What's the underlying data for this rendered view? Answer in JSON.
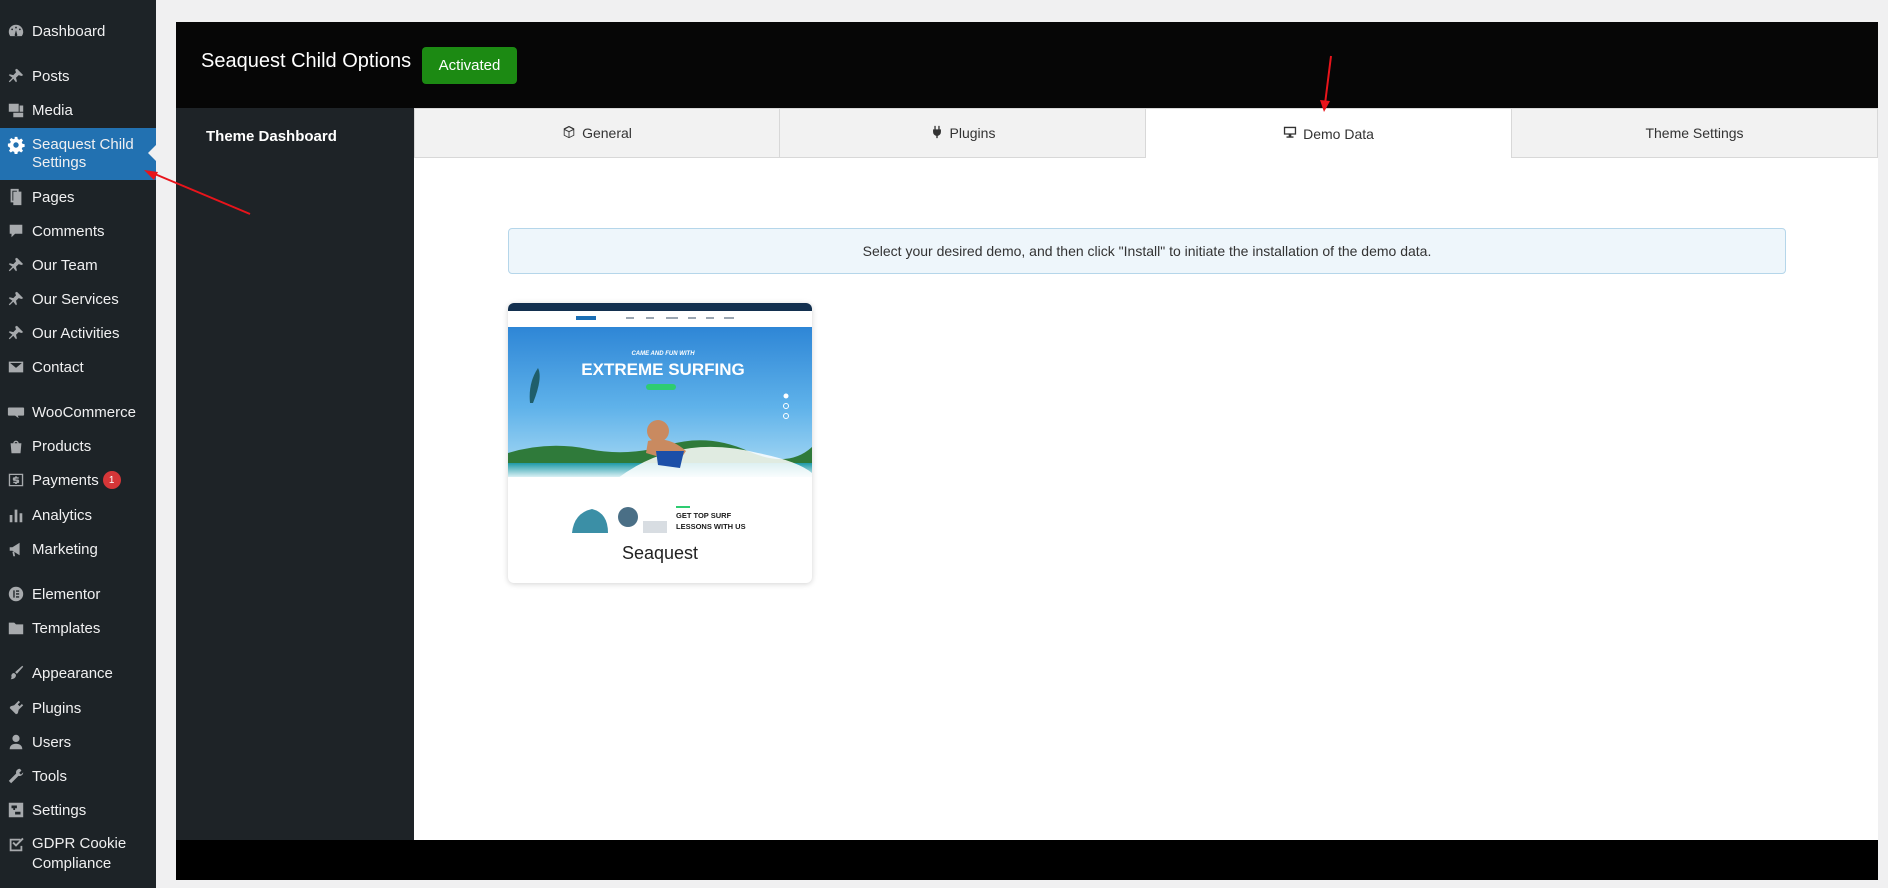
{
  "sidebar": {
    "items": [
      {
        "label": "Dashboard",
        "icon": "dashboard-icon"
      },
      {
        "label": "Posts",
        "icon": "pushpin-icon"
      },
      {
        "label": "Media",
        "icon": "media-icon"
      },
      {
        "label": "Seaquest Child Settings",
        "icon": "gear-icon",
        "active": true
      },
      {
        "label": "Pages",
        "icon": "pages-icon"
      },
      {
        "label": "Comments",
        "icon": "comment-icon"
      },
      {
        "label": "Our Team",
        "icon": "pushpin-icon"
      },
      {
        "label": "Our Services",
        "icon": "pushpin-icon"
      },
      {
        "label": "Our Activities",
        "icon": "pushpin-icon"
      },
      {
        "label": "Contact",
        "icon": "envelope-icon"
      },
      {
        "label": "WooCommerce",
        "icon": "woocommerce-icon"
      },
      {
        "label": "Products",
        "icon": "products-icon"
      },
      {
        "label": "Payments",
        "icon": "dollar-icon",
        "badge": "1"
      },
      {
        "label": "Analytics",
        "icon": "bar-chart-icon"
      },
      {
        "label": "Marketing",
        "icon": "megaphone-icon"
      },
      {
        "label": "Elementor",
        "icon": "elementor-icon"
      },
      {
        "label": "Templates",
        "icon": "folder-icon"
      },
      {
        "label": "Appearance",
        "icon": "paintbrush-icon"
      },
      {
        "label": "Plugins",
        "icon": "plug-icon"
      },
      {
        "label": "Users",
        "icon": "user-icon"
      },
      {
        "label": "Tools",
        "icon": "wrench-icon"
      },
      {
        "label": "Settings",
        "icon": "sliders-icon"
      },
      {
        "label": "GDPR Cookie Compliance",
        "icon": "checkbox-icon"
      }
    ]
  },
  "options": {
    "title": "Seaquest Child Options",
    "status": "Activated",
    "nav": {
      "theme_dashboard": "Theme Dashboard"
    },
    "tabs": [
      {
        "label": "General",
        "icon": "cube-icon"
      },
      {
        "label": "Plugins",
        "icon": "plug-icon"
      },
      {
        "label": "Demo Data",
        "icon": "monitor-icon",
        "active": true
      },
      {
        "label": "Theme Settings"
      }
    ],
    "notice": "Select your desired demo, and then click \"Install\" to initiate the installation of the demo data.",
    "demos": [
      {
        "name": "Seaquest",
        "preview": {
          "hero_kicker": "CAME AND FUN WITH",
          "hero_title": "EXTREME SURFING",
          "section_title_line1": "GET TOP SURF",
          "section_title_line2": "LESSONS WITH US"
        }
      }
    ]
  },
  "colors": {
    "wp_sidebar": "#1d2327",
    "wp_active": "#2271b1",
    "activated_green": "#1c8a13",
    "annotation_red": "#e8141b"
  }
}
